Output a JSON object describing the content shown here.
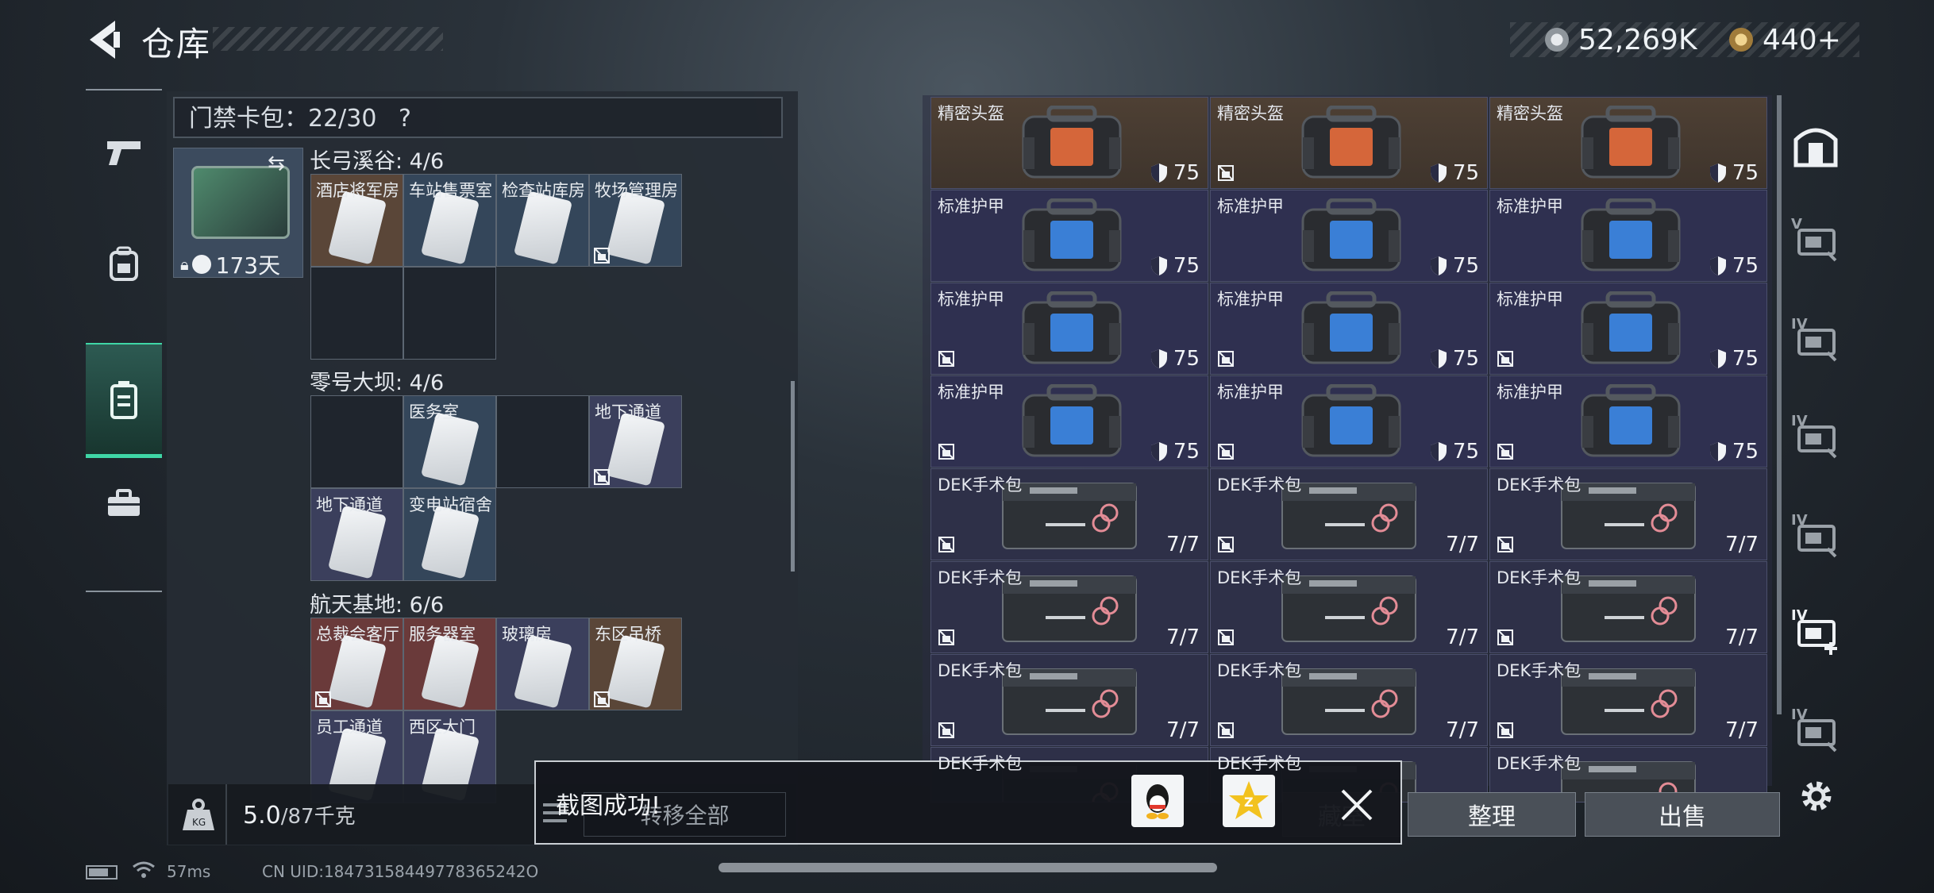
{
  "header": {
    "title": "仓库"
  },
  "currency": {
    "silver": "52,269K",
    "gold": "440+"
  },
  "left_nav": {
    "items": [
      {
        "icon": "pistol-icon",
        "active": false
      },
      {
        "icon": "backpack-icon",
        "active": false
      },
      {
        "icon": "keycard-case-icon",
        "active": true
      },
      {
        "icon": "briefcase-icon",
        "active": false
      }
    ]
  },
  "card_pack": {
    "label": "门禁卡包：22/30",
    "help": "?"
  },
  "key_case": {
    "days": "173天"
  },
  "regions": [
    {
      "title": "长弓溪谷: 4/6",
      "slots": [
        {
          "label": "酒店将军房",
          "color": "brown",
          "locked": false
        },
        {
          "label": "车站售票室",
          "color": "blue",
          "locked": false
        },
        {
          "label": "检查站库房",
          "color": "blue",
          "locked": false
        },
        {
          "label": "牧场管理房",
          "color": "blue",
          "locked": true
        }
      ]
    },
    {
      "title": "零号大坝: 4/6",
      "slots": [
        {
          "label": "",
          "color": "empty",
          "locked": false
        },
        {
          "label": "医务室",
          "color": "blue",
          "locked": false
        },
        {
          "label": "",
          "color": "empty",
          "locked": false
        },
        {
          "label": "地下通道",
          "color": "purple",
          "locked": true
        },
        {
          "label": "地下通道",
          "color": "purple",
          "locked": false
        },
        {
          "label": "变电站宿舍",
          "color": "blue",
          "locked": false
        }
      ]
    },
    {
      "title": "航天基地: 6/6",
      "slots": [
        {
          "label": "总裁会客厅",
          "color": "red",
          "locked": true
        },
        {
          "label": "服务器室",
          "color": "red",
          "locked": false
        },
        {
          "label": "玻璃房",
          "color": "purple",
          "locked": false
        },
        {
          "label": "东区吊桥",
          "color": "brown",
          "locked": true
        },
        {
          "label": "员工通道",
          "color": "purple",
          "locked": false
        },
        {
          "label": "西区大门",
          "color": "purple",
          "locked": false
        }
      ]
    }
  ],
  "weight": {
    "current": "5.0",
    "max": "/87千克"
  },
  "inventory": {
    "rows": [
      [
        {
          "name": "精密头盔",
          "type": "helmet",
          "value": "75",
          "locked": false
        },
        {
          "name": "精密头盔",
          "type": "helmet",
          "value": "75",
          "locked": true
        },
        {
          "name": "精密头盔",
          "type": "helmet",
          "value": "75",
          "locked": false
        }
      ],
      [
        {
          "name": "标准护甲",
          "type": "armor",
          "value": "75",
          "locked": false
        },
        {
          "name": "标准护甲",
          "type": "armor",
          "value": "75",
          "locked": false
        },
        {
          "name": "标准护甲",
          "type": "armor",
          "value": "75",
          "locked": false
        }
      ],
      [
        {
          "name": "标准护甲",
          "type": "armor",
          "value": "75",
          "locked": true
        },
        {
          "name": "标准护甲",
          "type": "armor",
          "value": "75",
          "locked": true
        },
        {
          "name": "标准护甲",
          "type": "armor",
          "value": "75",
          "locked": true
        }
      ],
      [
        {
          "name": "标准护甲",
          "type": "armor",
          "value": "75",
          "locked": true
        },
        {
          "name": "标准护甲",
          "type": "armor",
          "value": "75",
          "locked": true
        },
        {
          "name": "标准护甲",
          "type": "armor",
          "value": "75",
          "locked": true
        }
      ],
      [
        {
          "name": "DEK手术包",
          "type": "medkit",
          "value": "7/7",
          "locked": true
        },
        {
          "name": "DEK手术包",
          "type": "medkit",
          "value": "7/7",
          "locked": true
        },
        {
          "name": "DEK手术包",
          "type": "medkit",
          "value": "7/7",
          "locked": true
        }
      ],
      [
        {
          "name": "DEK手术包",
          "type": "medkit",
          "value": "7/7",
          "locked": true
        },
        {
          "name": "DEK手术包",
          "type": "medkit",
          "value": "7/7",
          "locked": true
        },
        {
          "name": "DEK手术包",
          "type": "medkit",
          "value": "7/7",
          "locked": true
        }
      ],
      [
        {
          "name": "DEK手术包",
          "type": "medkit",
          "value": "7/7",
          "locked": true
        },
        {
          "name": "DEK手术包",
          "type": "medkit",
          "value": "7/7",
          "locked": true
        },
        {
          "name": "DEK手术包",
          "type": "medkit",
          "value": "7/7",
          "locked": true
        }
      ],
      [
        {
          "name": "DEK手术包",
          "type": "medkit",
          "value": "",
          "locked": false
        },
        {
          "name": "DEK手术包",
          "type": "medkit",
          "value": "",
          "locked": false
        },
        {
          "name": "DEK手术包",
          "type": "medkit",
          "value": "",
          "locked": false
        }
      ]
    ]
  },
  "right_nav": {
    "items": [
      {
        "icon": "safe-box-icon",
        "tier": ""
      },
      {
        "icon": "card-holder-icon",
        "tier": "V"
      },
      {
        "icon": "card-holder-icon",
        "tier": "IV"
      },
      {
        "icon": "card-holder-icon",
        "tier": "IV"
      },
      {
        "icon": "card-holder-icon",
        "tier": "IV"
      },
      {
        "icon": "card-holder-add-icon",
        "tier": "IV"
      },
      {
        "icon": "card-holder-icon",
        "tier": "IV"
      }
    ]
  },
  "actions": {
    "transfer_all": "转移全部",
    "warehouse": "藏室",
    "organize": "整理",
    "sell": "出售"
  },
  "toast": {
    "message": "截图成功!"
  },
  "status": {
    "ping": "57ms",
    "uid": "CN UID:18473158449778365242O"
  }
}
